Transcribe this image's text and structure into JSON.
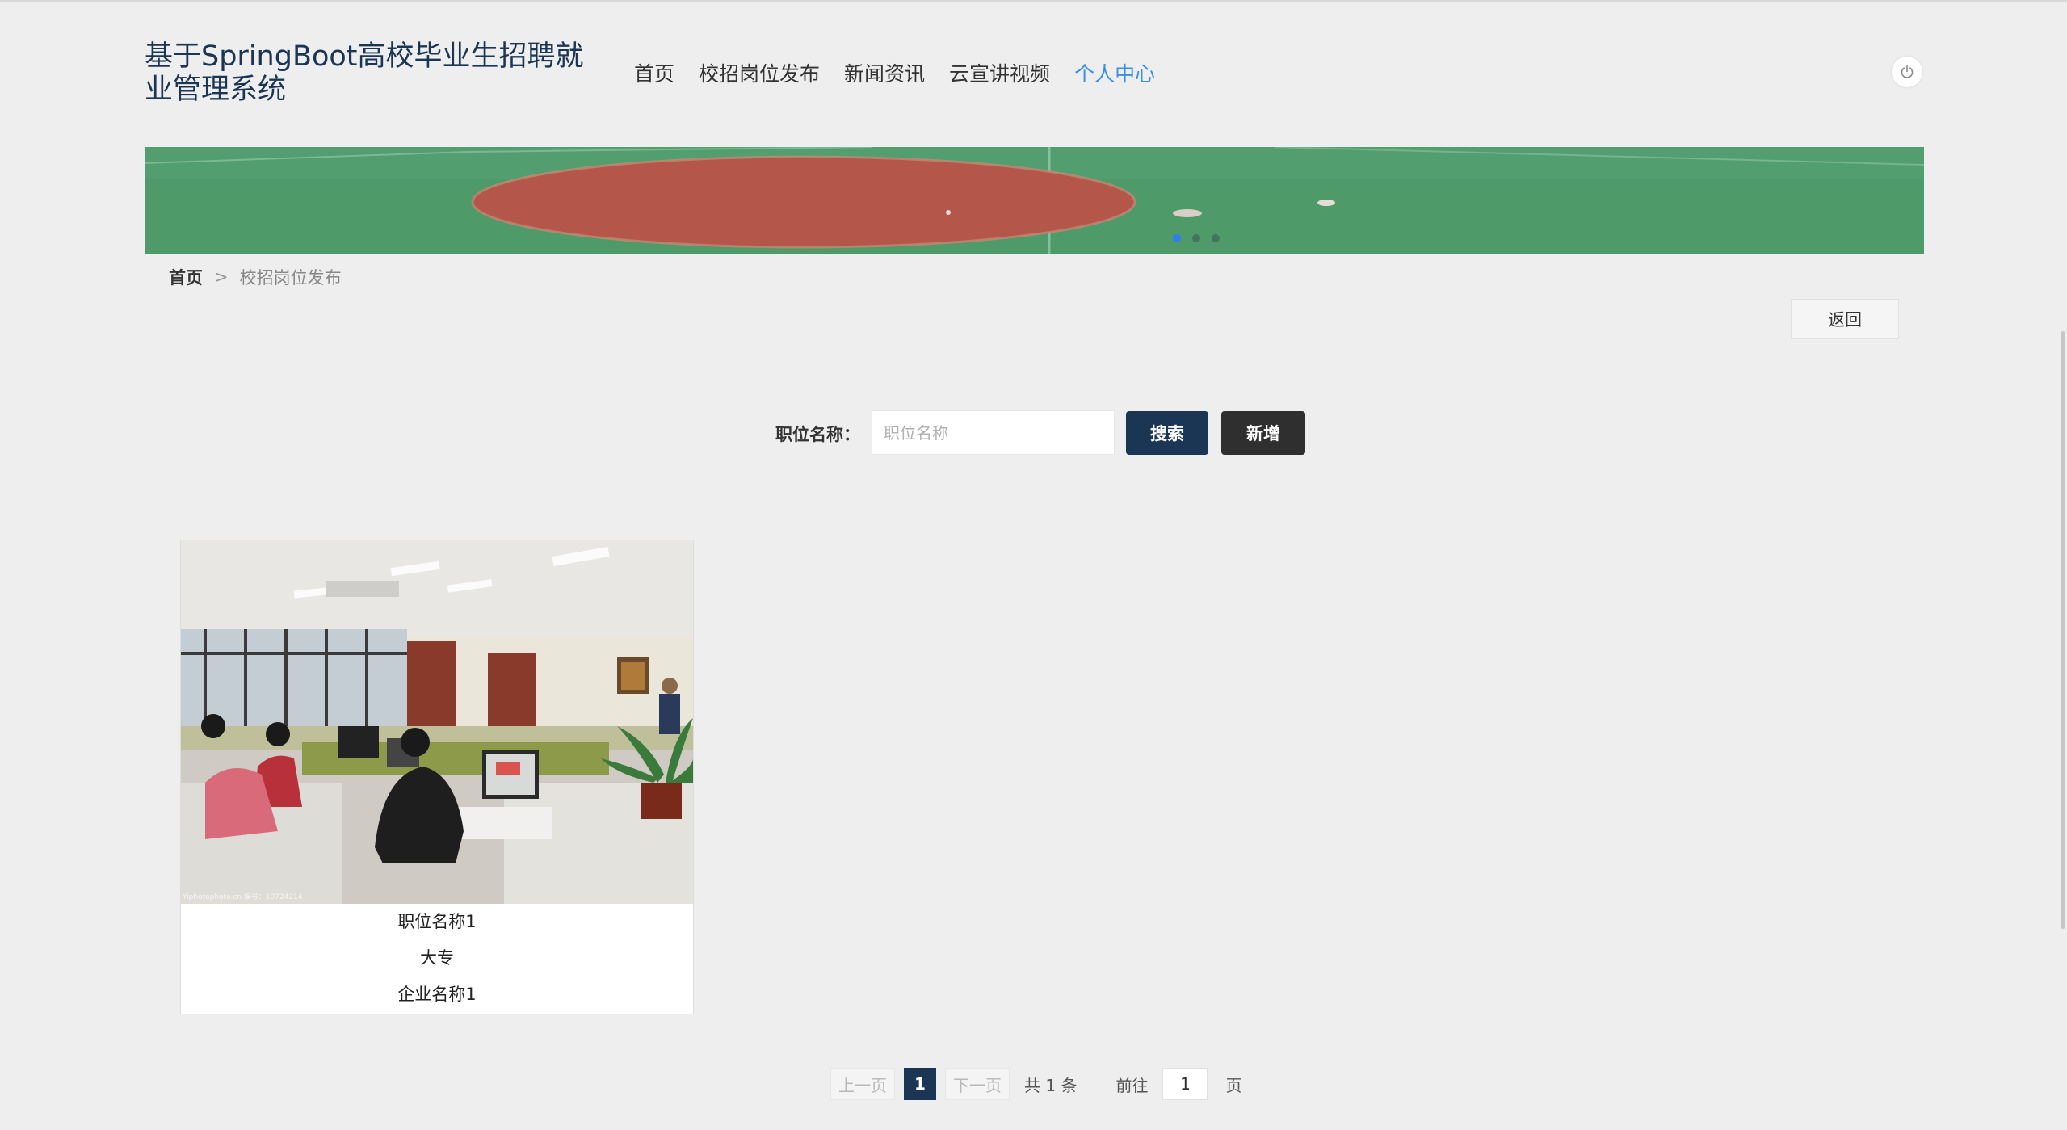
{
  "header": {
    "site_title": "基于SpringBoot高校毕业生招聘就业管理系统",
    "nav": [
      {
        "label": "首页",
        "active": false
      },
      {
        "label": "校招岗位发布",
        "active": false
      },
      {
        "label": "新闻资讯",
        "active": false
      },
      {
        "label": "云宣讲视频",
        "active": false
      },
      {
        "label": "个人中心",
        "active": true
      }
    ],
    "power_icon": "power-icon"
  },
  "banner": {
    "slides": 3,
    "active_slide": 1
  },
  "breadcrumb": {
    "home": "首页",
    "separator": ">",
    "current": "校招岗位发布"
  },
  "actions": {
    "back_label": "返回"
  },
  "search": {
    "label": "职位名称：",
    "placeholder": "职位名称",
    "value": "",
    "search_label": "搜索",
    "add_label": "新增"
  },
  "cards": [
    {
      "title": "职位名称1",
      "education": "大专",
      "company": "企业名称1",
      "watermark": "Yiphotophoto.cn 编号：10724214"
    }
  ],
  "pagination": {
    "prev": "上一页",
    "current": "1",
    "next": "下一页",
    "total": "共 1 条",
    "goto": "前往",
    "goto_value": "1",
    "page_suffix": "页"
  },
  "colors": {
    "primary": "#1b3655",
    "accent": "#3a8ee6",
    "background": "#eeeeee"
  }
}
